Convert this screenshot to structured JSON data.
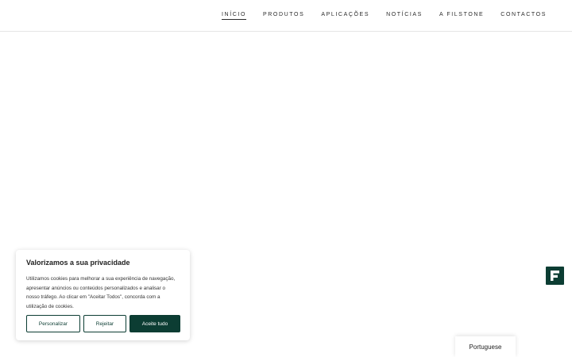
{
  "nav": {
    "items": [
      {
        "label": "INÍCIO",
        "active": true
      },
      {
        "label": "PRODUTOS",
        "active": false
      },
      {
        "label": "APLICAÇÕES",
        "active": false
      },
      {
        "label": "NOTÍCIAS",
        "active": false
      },
      {
        "label": "A FILSTONE",
        "active": false
      },
      {
        "label": "CONTACTOS",
        "active": false
      }
    ]
  },
  "cookie_banner": {
    "title": "Valorizamos a sua privacidade",
    "text": "Utilizamos cookies para melhorar a sua experiência de navegação, apresentar anúncios ou conteúdos personalizados e analisar o nosso tráfego. Ao clicar em \"Aceitar Todos\", concorda com a utilização de cookies.",
    "customize_label": "Personalizar",
    "reject_label": "Rejeitar",
    "accept_label": "Aceite tudo"
  },
  "floating_badge": {
    "icon": "filstone-f-logo-icon",
    "color": "#0c3d33"
  },
  "language": {
    "label": "Portuguese"
  },
  "colors": {
    "brand": "#0c3d33",
    "text": "#2b2b2b"
  }
}
